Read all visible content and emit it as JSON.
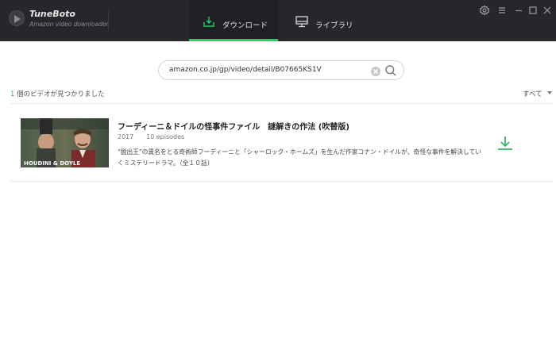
{
  "app": {
    "name": "TuneBoto",
    "subtitle": "Amazon video downloader",
    "logo_icon": "tuneboto-logo-icon"
  },
  "tabs": [
    {
      "label": "ダウンロード",
      "icon": "download-tray-icon",
      "active": true
    },
    {
      "label": "ライブラリ",
      "icon": "monitor-icon",
      "active": false
    }
  ],
  "window_controls": [
    "gear-icon",
    "menu-icon",
    "minimize-icon",
    "maximize-icon",
    "close-icon"
  ],
  "search": {
    "value": "amazon.co.jp/gp/video/detail/B07665KS1V"
  },
  "results": {
    "count": "1",
    "text": " 個のビデオが見つかりました"
  },
  "filter": {
    "selected": "すべて"
  },
  "videos": [
    {
      "title": "フーディーニ＆ドイルの怪事件ファイル　謎解きの作法 (吹替版)",
      "year": "2017",
      "episodes": "10 episodes",
      "description": "\"脱出王\"の異名をとる奇術師フーディーニと「シャーロック・ホームズ」を生んだ作家コナン・ドイルが、奇怪な事件を解決していくミステリードラマ。（全１０話）",
      "thumbnail_text": "HOUDINI & DOYLE"
    }
  ],
  "colors": {
    "titlebar": "#26272b",
    "accent": "#2fcc6b",
    "download_icon": "#2fb862"
  }
}
